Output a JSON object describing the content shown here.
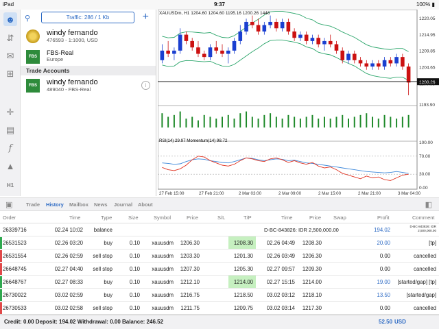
{
  "status": {
    "carrier": "iPad",
    "clock": "9:37",
    "battery": "100%"
  },
  "accounts": {
    "traffic": "Traffic: 286 / 1 Kb",
    "list": [
      {
        "name": "windy fernando",
        "sub": "476593 - 1:1000, USD"
      },
      {
        "name": "FBS-Real",
        "sub": "Europe"
      }
    ],
    "section_title": "Trade Accounts",
    "trade": [
      {
        "name": "windy fernando",
        "sub": "489040 - FBS-Real"
      }
    ]
  },
  "toolbar": {
    "timeframe": "H1"
  },
  "chart_data": {
    "type": "candlestick",
    "title": "XAUUSDm, H1  1204.60 1204.60 1195.16 1200.26 1446",
    "price_ticks": [
      "1220.05",
      "1214.95",
      "1209.85",
      "1204.65",
      "1199.55",
      "1193.90"
    ],
    "current_price": "1200.26",
    "indicator_title": "RSI(14) 29.97 Momentum(14) 98.72",
    "indicator_ticks": [
      "100.00",
      "70.00",
      "30.00",
      "0.00"
    ],
    "time_labels": [
      "27 Feb 15:00",
      "27 Feb 21:00",
      "2 Mar 03:00",
      "2 Mar 09:00",
      "2 Mar 15:00",
      "2 Mar 21:00",
      "3 Mar 04:00"
    ],
    "candles": [
      [
        1207,
        1212,
        1206,
        1210
      ],
      [
        1210,
        1213,
        1208,
        1209
      ],
      [
        1209,
        1211,
        1207,
        1210
      ],
      [
        1210,
        1217,
        1209,
        1215
      ],
      [
        1215,
        1216,
        1212,
        1213
      ],
      [
        1213,
        1214,
        1210,
        1211
      ],
      [
        1211,
        1213,
        1208,
        1209
      ],
      [
        1209,
        1210,
        1207,
        1208
      ],
      [
        1208,
        1212,
        1207,
        1211
      ],
      [
        1211,
        1213,
        1209,
        1210
      ],
      [
        1210,
        1212,
        1208,
        1209
      ],
      [
        1209,
        1211,
        1206,
        1210
      ],
      [
        1210,
        1214,
        1209,
        1213
      ],
      [
        1213,
        1218,
        1212,
        1216
      ],
      [
        1216,
        1220,
        1215,
        1219
      ],
      [
        1219,
        1221,
        1217,
        1218
      ],
      [
        1218,
        1220,
        1215,
        1216
      ],
      [
        1216,
        1219,
        1215,
        1218
      ],
      [
        1218,
        1221,
        1217,
        1219
      ],
      [
        1219,
        1220,
        1216,
        1217
      ],
      [
        1217,
        1220,
        1216,
        1219
      ],
      [
        1219,
        1220,
        1215,
        1216
      ],
      [
        1216,
        1217,
        1213,
        1214
      ],
      [
        1214,
        1216,
        1213,
        1215
      ],
      [
        1215,
        1216,
        1212,
        1213
      ],
      [
        1213,
        1215,
        1212,
        1214
      ],
      [
        1214,
        1215,
        1211,
        1212
      ],
      [
        1212,
        1214,
        1210,
        1213
      ],
      [
        1213,
        1215,
        1211,
        1212
      ],
      [
        1212,
        1213,
        1209,
        1210
      ],
      [
        1210,
        1211,
        1206,
        1207
      ],
      [
        1207,
        1210,
        1206,
        1209
      ],
      [
        1209,
        1210,
        1206,
        1207
      ],
      [
        1207,
        1208,
        1205,
        1206
      ],
      [
        1206,
        1207,
        1204,
        1205
      ],
      [
        1205,
        1207,
        1204,
        1206
      ],
      [
        1206,
        1207,
        1204,
        1205
      ],
      [
        1205,
        1208,
        1204,
        1207
      ],
      [
        1207,
        1208,
        1205,
        1206
      ],
      [
        1206,
        1209,
        1205,
        1208
      ],
      [
        1208,
        1209,
        1204,
        1205
      ],
      [
        1205,
        1206,
        1196,
        1200
      ]
    ],
    "volumes": [
      8,
      6,
      7,
      9,
      5,
      6,
      4,
      7,
      6,
      5,
      6,
      7,
      5,
      8,
      9,
      6,
      5,
      7,
      8,
      6,
      5,
      7,
      6,
      5,
      6,
      7,
      5,
      6,
      5,
      6,
      7,
      5,
      6,
      7,
      8,
      6,
      5,
      7,
      6,
      5,
      6,
      7
    ],
    "rsi": [
      45,
      40,
      38,
      42,
      50,
      62,
      70,
      68,
      60,
      55,
      50,
      48,
      52,
      60,
      66,
      64,
      60,
      58,
      64,
      66,
      62,
      56,
      60,
      55,
      52,
      56,
      48,
      44,
      46,
      40,
      32,
      28,
      24,
      20,
      26,
      22,
      24,
      18,
      16,
      22,
      28,
      30
    ],
    "momentum": [
      55,
      54,
      52,
      53,
      58,
      62,
      64,
      63,
      60,
      58,
      56,
      55,
      58,
      62,
      66,
      65,
      62,
      60,
      62,
      64,
      63,
      60,
      61,
      58,
      55,
      54,
      52,
      50,
      48,
      46,
      44,
      42,
      40,
      38,
      36,
      35,
      34,
      33,
      34,
      36,
      34,
      32
    ]
  },
  "tabs": [
    "Trade",
    "History",
    "Mailbox",
    "News",
    "Journal",
    "About"
  ],
  "table": {
    "headers": [
      "Order",
      "Time",
      "Type",
      "Size",
      "Symbol",
      "Price",
      "S/L",
      "T/P",
      "Time",
      "Price",
      "Swap",
      "Profit",
      "Comment"
    ],
    "rows": [
      {
        "order": "26339716",
        "time": "02.24 10:02",
        "type": "balance",
        "size": "",
        "symbol": "",
        "price": "",
        "sl": "",
        "tp": "",
        "time2": "D-BC-843826: IDR 2,500,000.00",
        "price2": "",
        "swap": "",
        "profit": "194.02",
        "comment": "D-BC-843826: IDR 2,500,000.00",
        "flag": "balance"
      },
      {
        "order": "26531523",
        "time": "02.26 03:20",
        "type": "buy",
        "size": "0.10",
        "symbol": "xauusdm",
        "price": "1206.30",
        "sl": "",
        "tp": "1208.30",
        "time2": "02.26 04:49",
        "price2": "1208.30",
        "swap": "",
        "profit": "20.00",
        "comment": "[tp]",
        "flag": "win",
        "tphl": true
      },
      {
        "order": "26531554",
        "time": "02.26 02:59",
        "type": "sell stop",
        "size": "0.10",
        "symbol": "xauusdm",
        "price": "1203.30",
        "sl": "",
        "tp": "1201.30",
        "time2": "02.26 03:49",
        "price2": "1206.30",
        "swap": "",
        "profit": "0.00",
        "comment": "cancelled",
        "flag": "loss"
      },
      {
        "order": "26648745",
        "time": "02.27 04:40",
        "type": "sell stop",
        "size": "0.10",
        "symbol": "xauusdm",
        "price": "1207.30",
        "sl": "",
        "tp": "1205.30",
        "time2": "02.27 09:57",
        "price2": "1209.30",
        "swap": "",
        "profit": "0.00",
        "comment": "cancelled",
        "flag": "loss"
      },
      {
        "order": "26648767",
        "time": "02.27 08:33",
        "type": "buy",
        "size": "0.10",
        "symbol": "xauusdm",
        "price": "1212.10",
        "sl": "",
        "tp": "1214.00",
        "time2": "02.27 15:15",
        "price2": "1214.00",
        "swap": "",
        "profit": "19.00",
        "comment": "[started/gap] [tp]",
        "flag": "win",
        "tphl": true
      },
      {
        "order": "26730022",
        "time": "03.02 02:59",
        "type": "buy",
        "size": "0.10",
        "symbol": "xauusdm",
        "price": "1216.75",
        "sl": "",
        "tp": "1218.50",
        "time2": "03.02 03:12",
        "price2": "1218.10",
        "swap": "",
        "profit": "13.50",
        "comment": "[started/gap]",
        "flag": "win"
      },
      {
        "order": "26730533",
        "time": "03.02 02:58",
        "type": "sell stop",
        "size": "0.10",
        "symbol": "xauusdm",
        "price": "1211.75",
        "sl": "",
        "tp": "1209.75",
        "time2": "03.02 03:14",
        "price2": "1217.30",
        "swap": "",
        "profit": "0.00",
        "comment": "cancelled",
        "flag": "loss"
      }
    ]
  },
  "footer": {
    "summary": "Credit: 0.00 Deposit: 194.02 Withdrawal: 0.00 Balance: 246.52",
    "total": "52.50",
    "currency": "USD"
  },
  "colors": {
    "accent": "#2e6bc4",
    "bull": "#1a3fd0",
    "bear": "#cc1111",
    "volume": "#1f8a2a",
    "band": "#2aa56a",
    "rsi": "#e0301e",
    "momentum": "#3a86d9",
    "win": "#2fa84f",
    "loss": "#e04848"
  }
}
